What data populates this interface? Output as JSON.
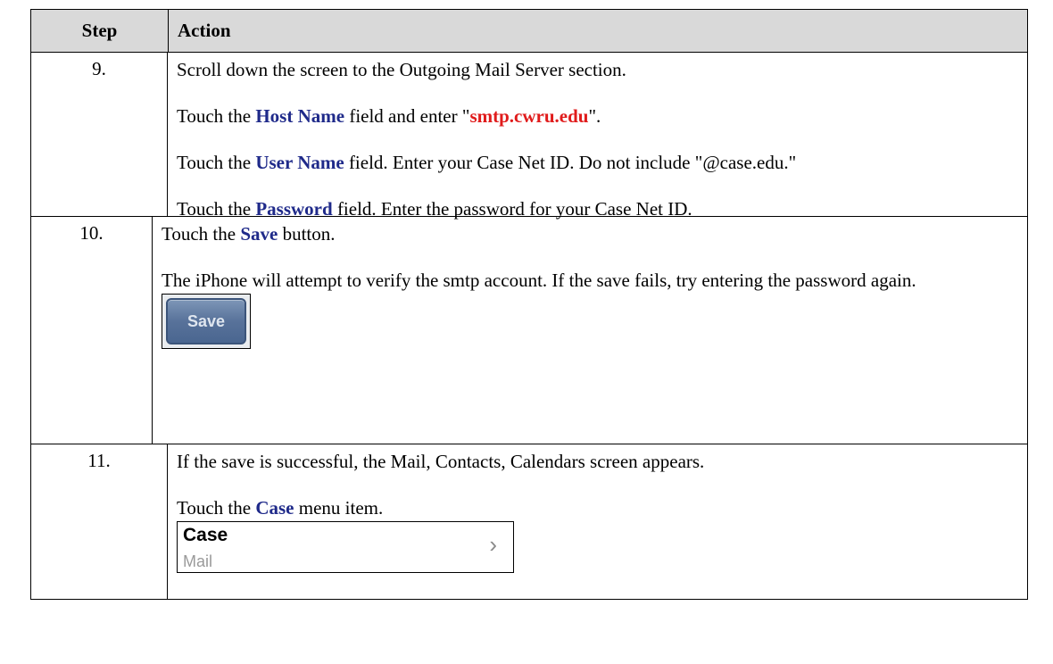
{
  "header": {
    "step": "Step",
    "action": "Action"
  },
  "rows": [
    {
      "step": "9.",
      "p1": "Scroll down the screen to the Outgoing Mail Server section.",
      "p2_pre": "Touch the ",
      "p2_kw": "Host Name",
      "p2_mid": " field and enter \"",
      "p2_val": "smtp.cwru.edu",
      "p2_post": "\".",
      "p3_pre": "Touch the ",
      "p3_kw": "User Name",
      "p3_post": " field.  Enter your Case Net ID.  Do not include \"@case.edu.\"",
      "p4_pre": "Touch the ",
      "p4_kw": "Password",
      "p4_post": " field.  Enter the password for your Case Net ID."
    },
    {
      "step": "10.",
      "p1_pre": "Touch the ",
      "p1_kw": "Save",
      "p1_post": " button.",
      "p2": "The iPhone will attempt to verify the smtp account.  If the save fails, try entering the password again.",
      "button_label": "Save"
    },
    {
      "step": "11.",
      "p1": "If the save is successful, the Mail, Contacts, Calendars screen appears.",
      "p2_pre": "Touch the ",
      "p2_kw": "Case",
      "p2_post": " menu item.",
      "menu_item_title": "Case",
      "menu_item_subtitle": "Mail",
      "chevron_icon": "chevron-right-icon"
    }
  ]
}
